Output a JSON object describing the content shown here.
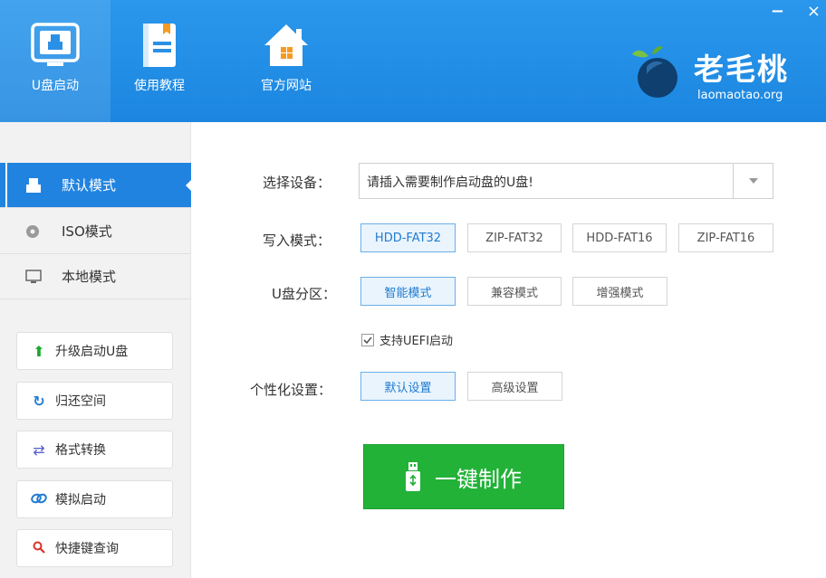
{
  "header": {
    "tabs": [
      {
        "label": "U盘启动",
        "icon": "usb-monitor-icon"
      },
      {
        "label": "使用教程",
        "icon": "book-icon"
      },
      {
        "label": "官方网站",
        "icon": "home-icon"
      }
    ],
    "window": {
      "minimize": "−",
      "close": "×"
    },
    "logo": {
      "name": "老毛桃",
      "url": "laomaotao.org"
    }
  },
  "sidebar": {
    "modes": [
      {
        "label": "默认模式",
        "icon": "usb-drive-icon",
        "active": true
      },
      {
        "label": "ISO模式",
        "icon": "disc-icon",
        "active": false
      },
      {
        "label": "本地模式",
        "icon": "monitor-icon",
        "active": false
      }
    ],
    "tools": [
      {
        "label": "升级启动U盘",
        "icon": "arrow-up-icon"
      },
      {
        "label": "归还空间",
        "icon": "refresh-icon"
      },
      {
        "label": "格式转换",
        "icon": "swap-icon"
      },
      {
        "label": "模拟启动",
        "icon": "link-icon"
      },
      {
        "label": "快捷键查询",
        "icon": "search-icon"
      }
    ]
  },
  "main": {
    "device": {
      "label": "选择设备：",
      "value": "请插入需要制作启动盘的U盘!"
    },
    "write_mode": {
      "label": "写入模式：",
      "options": [
        "HDD-FAT32",
        "ZIP-FAT32",
        "HDD-FAT16",
        "ZIP-FAT16"
      ],
      "selected": "HDD-FAT32"
    },
    "partition": {
      "label": "U盘分区：",
      "options": [
        "智能模式",
        "兼容模式",
        "增强模式"
      ],
      "selected": "智能模式"
    },
    "uefi": {
      "label": "支持UEFI启动",
      "checked": true
    },
    "personalize": {
      "label": "个性化设置：",
      "options": [
        "默认设置",
        "高级设置"
      ],
      "selected": "默认设置"
    },
    "make_button": "一键制作"
  },
  "colors": {
    "header": "#1c86e0",
    "active_mode": "#2183e0",
    "make_button": "#22b238",
    "selected_border": "#6aaee8"
  }
}
